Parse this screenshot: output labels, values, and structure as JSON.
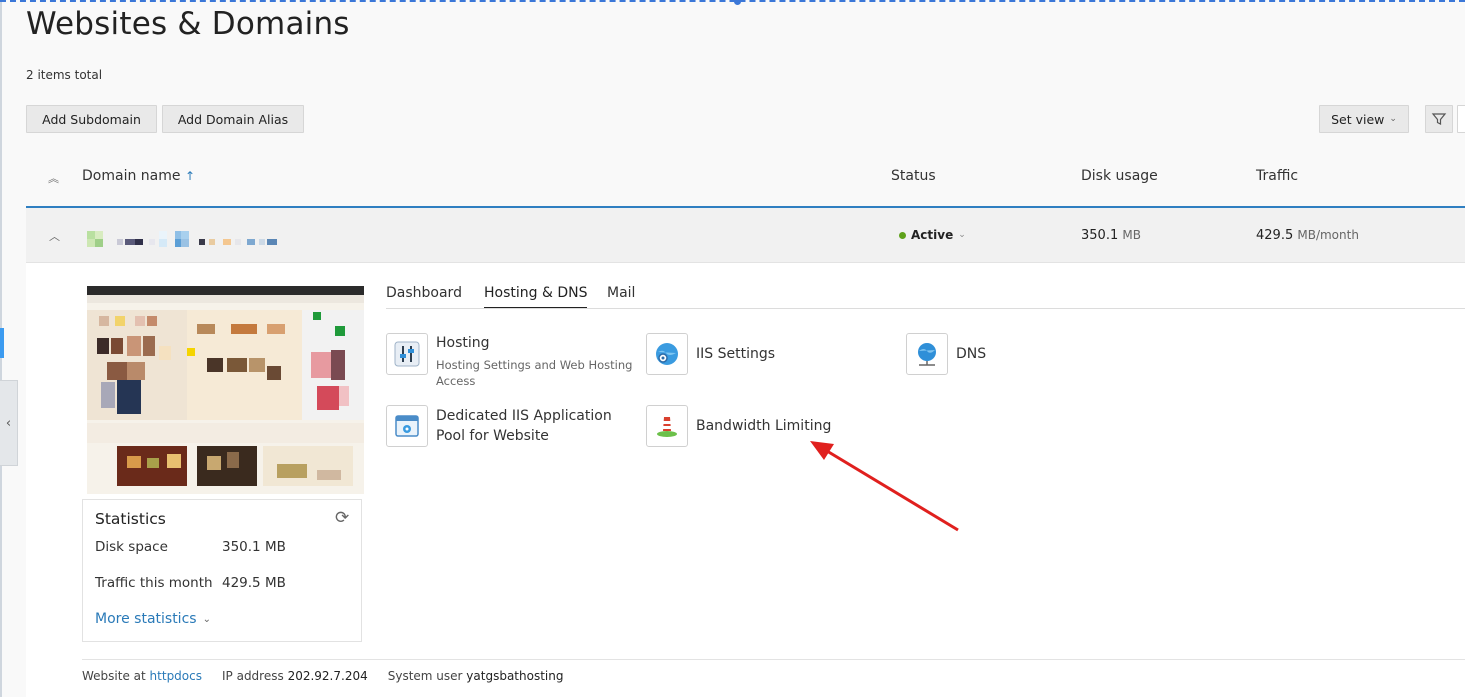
{
  "page": {
    "title": "Websites & Domains",
    "items_total": "2 items total"
  },
  "toolbar": {
    "add_subdomain": "Add Subdomain",
    "add_domain_alias": "Add Domain Alias",
    "set_view": "Set view",
    "filter_icon": "filter-icon"
  },
  "table": {
    "columns": {
      "domain_name": "Domain name",
      "sort_indicator": "↑",
      "status": "Status",
      "disk_usage": "Disk usage",
      "traffic": "Traffic"
    },
    "row": {
      "status": "Active",
      "disk_value": "350.1",
      "disk_unit": "MB",
      "traffic_value": "429.5",
      "traffic_unit": "MB/month"
    }
  },
  "colors": {
    "accent": "#2f7fc1",
    "link": "#2a7ab8",
    "status_active": "#5ea11a",
    "annotation_arrow": "#e0201e"
  },
  "tabs": [
    "Dashboard",
    "Hosting & DNS",
    "Mail"
  ],
  "active_tab": "Hosting & DNS",
  "tools": {
    "hosting": {
      "title": "Hosting",
      "subtitle": "Hosting Settings and Web Hosting Access",
      "icon": "sliders-icon"
    },
    "iis_settings": {
      "title": "IIS Settings",
      "icon": "globe-gear-icon"
    },
    "dns": {
      "title": "DNS",
      "icon": "globe-network-icon"
    },
    "app_pool": {
      "title": "Dedicated IIS Application Pool for Website",
      "icon": "window-gear-icon"
    },
    "bandwidth": {
      "title": "Bandwidth Limiting",
      "icon": "bandwidth-icon"
    }
  },
  "statistics": {
    "title": "Statistics",
    "disk_label": "Disk space",
    "disk_value": "350.1 MB",
    "traffic_label": "Traffic this month",
    "traffic_value": "429.5 MB",
    "more": "More statistics"
  },
  "footer": {
    "website_at_label": "Website at",
    "website_at_link": "httpdocs",
    "ip_label": "IP address",
    "ip_value": "202.92.7.204",
    "sysuser_label": "System user",
    "sysuser_value": "yatgsbathosting"
  }
}
